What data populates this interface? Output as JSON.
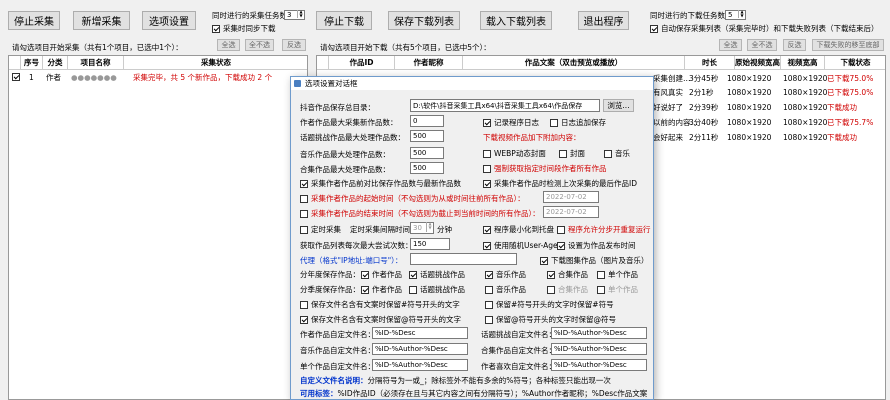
{
  "left_toolbar": {
    "stop_collect": "停止采集",
    "add_collect": "新增采集",
    "options": "选项设置",
    "concurrent_label": "同时进行的采集任务数",
    "concurrent_value": "3",
    "sync_download": "采集时同步下载"
  },
  "right_toolbar": {
    "stop_download": "停止下载",
    "save_list": "保存下载列表",
    "load_list": "载入下载列表",
    "exit": "退出程序",
    "concurrent_label": "同时进行的下载任务数",
    "concurrent_value": "5",
    "auto_save": "自动保存采集列表（采集完毕时）和下载失败列表（下载结束后）"
  },
  "left_list": {
    "hint": "请勾选项目开始采集（共有1个项目，已选中1个）：",
    "select_all": "全选",
    "select_none": "全不选",
    "invert": "反选",
    "columns": [
      "序号",
      "分类",
      "项目名称",
      "采集状态"
    ],
    "rows": [
      {
        "no": "1",
        "cat": "作者",
        "name": "●●●●●●●",
        "status": "采集完毕，共 5 个新作品，下载成功 2 个"
      }
    ]
  },
  "right_list": {
    "hint": "请勾选项目开始下载（共有5个项目，已选中5个）：",
    "select_all": "全选",
    "select_none": "全不选",
    "invert": "反选",
    "move_bottom": "下载失败的移至底部",
    "columns": [
      "作品ID",
      "作者昵称",
      "作品文案（双击预览或播放）",
      "时长",
      "原始视频宽高",
      "视频宽高",
      "下载状态"
    ],
    "rows": [
      {
        "title": "采集创建…",
        "dur": "3分45秒",
        "orig": "1080×1920",
        "size": "1080×1920",
        "status": "已下载75.0%"
      },
      {
        "title": "有风真实",
        "dur": "2分1秒",
        "orig": "1080×1920",
        "size": "1080×1920",
        "status": "已下载75.0%"
      },
      {
        "title": "好说好了",
        "dur": "2分39秒",
        "orig": "1080×1920",
        "size": "1080×1920",
        "status": "下载成功"
      },
      {
        "title": "以前的内容…",
        "dur": "3分40秒",
        "orig": "1080×1920",
        "size": "1080×1920",
        "status": "已下载75.7%"
      },
      {
        "title": "会好起来",
        "dur": "2分11秒",
        "orig": "1080×1920",
        "size": "1080×1920",
        "status": "下载成功"
      }
    ]
  },
  "dialog": {
    "title": "选项设置对话框",
    "save_dir_label": "抖音作品保存总目录：",
    "save_dir_value": "D:\\软件\\抖音采集工具x64\\抖音采集工具x64\\作品保存",
    "browse": "浏览...",
    "f1_label": "作者作品最大采集新作品数：",
    "f1_value": "0",
    "f2_label": "话题挑战作品最大处理作品数：",
    "f2_value": "500",
    "f3_label": "音乐作品最大处理作品数：",
    "f3_value": "500",
    "f4_label": "合集作品最大处理作品数：",
    "f4_value": "500",
    "log_program": "记录程序日志",
    "log_append": "日志追加保存",
    "dl_extra": "下载视频作品加下附加内容：",
    "webp": "WEBP动态封面",
    "cover": "封面",
    "music": "音乐",
    "force_fetch": "强制获取指定时间段作者所有作品",
    "compare_first": "采集作者作品前对比保存作品数与最新作品数",
    "detect_last": "采集作者作品时检测上次采集的最后作品ID",
    "start_time_label": "采集作者作品的起始时间（不勾选则为从或时间往前所有作品）：",
    "start_time_value": "2022-07-02",
    "end_time_label": "采集作者作品的结束时间（不勾选则为截止到当前时间的所有作品）：",
    "end_time_value": "2022-07-02",
    "timed_collect": "定时采集",
    "timed_interval_label": "定时采集间隔时间：",
    "timed_interval_value": "30",
    "minutes": "分钟",
    "minimize_tray": "程序最小化到托盘",
    "auto_restart": "程序允许分步开重复运行",
    "list_max_label": "获取作品列表每次最大尝试次数：",
    "list_max_value": "150",
    "random_ua": "使用随机User-Agent",
    "set_file_time": "设置为作品发布时间",
    "proxy_label": "代理（格式\"IP地址:端口号\"）：",
    "dl_image_works": "下载图集作品（图片及音乐）",
    "cat_save_label": "分年度保存作品：",
    "cat_month_label": "分季度保存作品：",
    "author_works": "作者作品",
    "topic_works": "话题挑战作品",
    "music_works": "音乐作品",
    "collection_works": "合集作品",
    "single_works": "单个作品",
    "keep_text1": "保存文件名含有文案时保留#符号开头的文字",
    "keep_text1b": "保留#符号开头的文字时保留#符号",
    "keep_text2": "保存文件名含有文案时保留@符号开头的文字",
    "keep_text2b": "保留@符号开头的文字时保留@符号",
    "author_name_label": "作者作品自定文件名：",
    "author_name_value": "%ID-%Desc",
    "topic_name_label": "话题挑战自定文件名：",
    "topic_name_value": "%ID-%Author-%Desc",
    "music_name_label": "音乐作品自定文件名：",
    "music_name_value": "%ID-%Author-%Desc",
    "coll_name_label": "合集作品自定文件名：",
    "coll_name_value": "%ID-%Author-%Desc",
    "single_name_label": "单个作品自定文件名：",
    "single_name_value": "%ID-%Author-%Desc",
    "fav_name_label": "作者喜欢自定文件名：",
    "fav_name_value": "%ID-%Author-%Desc",
    "custom_note_label": "自定义文件名说明：",
    "custom_note": "分隔符号为一或_；除标签外不能有多余的%符号；各种标签只能出现一次",
    "tags_label": "可用标签：",
    "tags_text": "%ID作品ID（必须存在且与其它内容之间有分隔符号）；%Author作者昵称；%Desc作品文案"
  },
  "colors": {
    "accent_red": "#d00000",
    "accent_blue": "#0033cc",
    "dialog_border": "#6f9bcc"
  }
}
